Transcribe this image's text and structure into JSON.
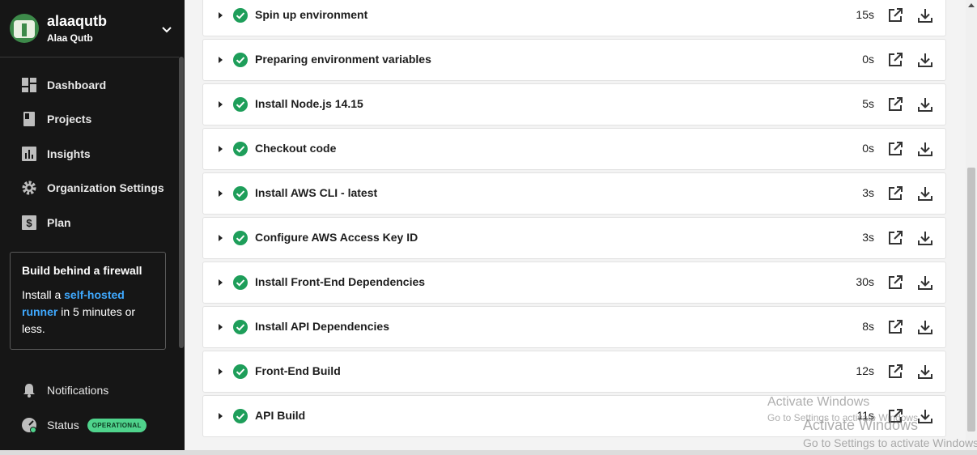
{
  "org": {
    "name": "alaaqutb",
    "user": "Alaa Qutb"
  },
  "nav": {
    "items": [
      {
        "label": "Dashboard",
        "icon": "dashboard-icon"
      },
      {
        "label": "Projects",
        "icon": "projects-icon"
      },
      {
        "label": "Insights",
        "icon": "insights-icon"
      },
      {
        "label": "Organization Settings",
        "icon": "gear-icon"
      },
      {
        "label": "Plan",
        "icon": "dollar-icon"
      }
    ],
    "notifications": "Notifications",
    "status": "Status",
    "status_badge": "OPERATIONAL"
  },
  "promo": {
    "title": "Build behind a firewall",
    "text_before": "Install a ",
    "link": "self-hosted runner",
    "text_after": " in 5 minutes or less."
  },
  "steps": [
    {
      "name": "Spin up environment",
      "time": "15s"
    },
    {
      "name": "Preparing environment variables",
      "time": "0s"
    },
    {
      "name": "Install Node.js 14.15",
      "time": "5s"
    },
    {
      "name": "Checkout code",
      "time": "0s"
    },
    {
      "name": "Install AWS CLI - latest",
      "time": "3s"
    },
    {
      "name": "Configure AWS Access Key ID",
      "time": "3s"
    },
    {
      "name": "Install Front-End Dependencies",
      "time": "30s"
    },
    {
      "name": "Install API Dependencies",
      "time": "8s"
    },
    {
      "name": "Front-End Build",
      "time": "12s"
    },
    {
      "name": "API Build",
      "time": "11s"
    }
  ],
  "watermarks": [
    {
      "title": "Activate Windows",
      "subtitle": "Go to Settings to activate Windows."
    },
    {
      "title": "Activate Windows",
      "subtitle": "Go to Settings to activate Windows."
    }
  ],
  "colors": {
    "sidebar_bg": "#161616",
    "success_green": "#1e9e5a",
    "link_blue": "#3fa9ff",
    "badge_green": "#4fd38c"
  }
}
